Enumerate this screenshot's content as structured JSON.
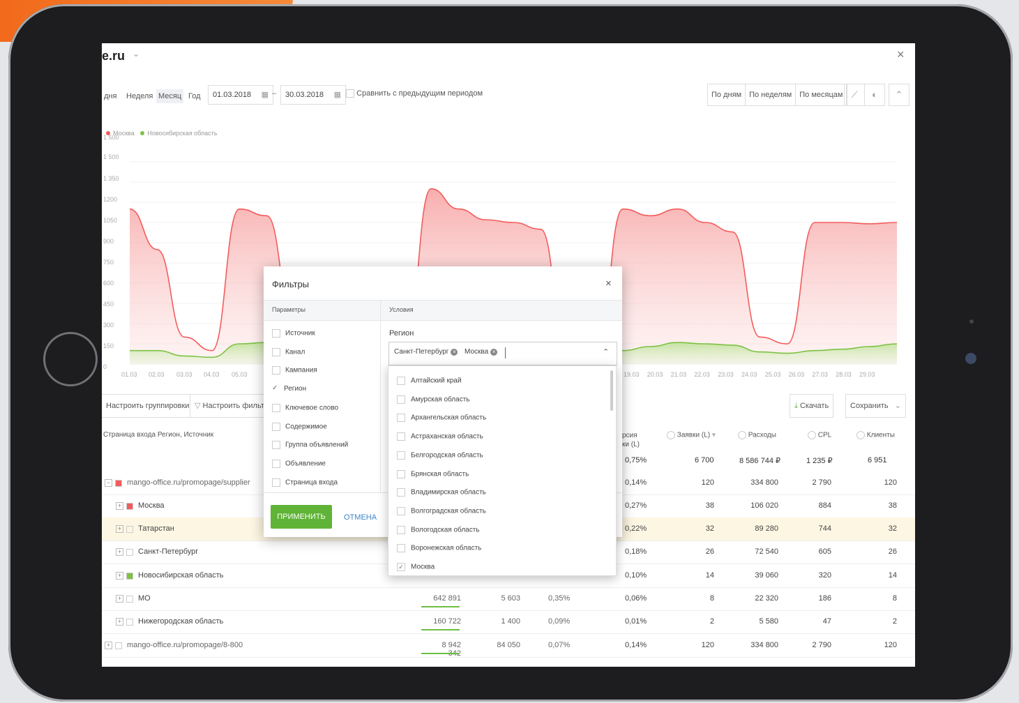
{
  "header": {
    "site": "e.ru",
    "chevron": "⌄",
    "close": "×"
  },
  "toolbar": {
    "ranges": [
      "дня",
      "Неделя",
      "Месяц",
      "Год"
    ],
    "active_range": "Месяц",
    "date_from": "01.03.2018",
    "dash": "–",
    "date_to": "30.03.2018",
    "compare_label": "Сравнить с предыдущим периодом",
    "group_by": [
      "По дням",
      "По неделям",
      "По месяцам"
    ]
  },
  "chart_data": {
    "type": "area",
    "legend": [
      "Москва",
      "Новосибирская область"
    ],
    "y_ticks": [
      "1 500",
      "1 500",
      "1 350",
      "1200",
      "1050",
      "900",
      "750",
      "600",
      "450",
      "300",
      "150",
      "0"
    ],
    "x_ticks_left": [
      "01.03",
      "02.03",
      "03.03",
      "04.03",
      "05.03"
    ],
    "x_ticks_right": [
      "19.03",
      "20.03",
      "21.03",
      "22.03",
      "23.03",
      "24.03",
      "25.03",
      "26.03",
      "27.03",
      "28.03",
      "29.03"
    ],
    "series": [
      {
        "name": "Москва",
        "color": "#f25c5c",
        "x": [
          "01.03",
          "02.03",
          "03.03",
          "04.03",
          "05.03",
          "06.03",
          "07.03",
          "08.03",
          "09.03",
          "10.03",
          "11.03",
          "12.03",
          "13.03",
          "14.03",
          "15.03",
          "16.03",
          "17.03",
          "18.03",
          "19.03",
          "20.03",
          "21.03",
          "22.03",
          "23.03",
          "24.03",
          "25.03",
          "26.03",
          "27.03",
          "28.03",
          "29.03"
        ],
        "values": [
          1150,
          850,
          200,
          100,
          1150,
          1100,
          300,
          0,
          0,
          0,
          0,
          1300,
          1150,
          1070,
          1050,
          1000,
          0,
          0,
          1150,
          1100,
          1150,
          1050,
          980,
          200,
          150,
          1050,
          1050,
          1040,
          1050
        ]
      },
      {
        "name": "Новосибирская область",
        "color": "#7cc243",
        "x": [
          "01.03",
          "02.03",
          "03.03",
          "04.03",
          "05.03",
          "06.03",
          "07.03",
          "08.03",
          "09.03",
          "10.03",
          "11.03",
          "12.03",
          "13.03",
          "14.03",
          "15.03",
          "16.03",
          "17.03",
          "18.03",
          "19.03",
          "20.03",
          "21.03",
          "22.03",
          "23.03",
          "24.03",
          "25.03",
          "26.03",
          "27.03",
          "28.03",
          "29.03"
        ],
        "values": [
          100,
          100,
          60,
          50,
          150,
          160,
          100,
          0,
          0,
          0,
          0,
          0,
          0,
          0,
          0,
          0,
          0,
          0,
          100,
          130,
          160,
          150,
          140,
          90,
          80,
          100,
          110,
          130,
          150
        ]
      }
    ],
    "ylim": [
      0,
      1500
    ]
  },
  "table_toolbar": {
    "grouping": "Настроить группировки",
    "filter": "Настроить фильтр",
    "download": "Скачать",
    "save": "Сохранить"
  },
  "table": {
    "first_header": "Страница входа Регион, Источник",
    "headers": [
      "рсия",
      "ки (L)",
      "Заявки (L)",
      "Расходы",
      "CPL",
      "Клиенты"
    ],
    "totals": [
      "0,75%",
      "6 700",
      "8 586 744 ₽",
      "1 235 ₽",
      "6 951"
    ],
    "rows": [
      {
        "name": "mango-office.ru/promopage/supplier",
        "sign": "−",
        "mid1": "",
        "mid2": "",
        "mid3": "",
        "conv": "0,14%",
        "leads": "120",
        "cost": "334 800",
        "cpl": "2 790",
        "clients": "120"
      },
      {
        "name": "Москва",
        "sign": "+",
        "mid1": "",
        "mid2": "",
        "mid3": "",
        "conv": "0,27%",
        "leads": "38",
        "cost": "106 020",
        "cpl": "884",
        "clients": "38"
      },
      {
        "name": "Татарстан",
        "sign": "+",
        "mid1": "",
        "mid2": "",
        "mid3": "",
        "conv": "0,22%",
        "leads": "32",
        "cost": "89 280",
        "cpl": "744",
        "clients": "32"
      },
      {
        "name": "Санкт-Петербург",
        "sign": "+",
        "mid1": "",
        "mid2": "",
        "mid3": "",
        "conv": "0,18%",
        "leads": "26",
        "cost": "72 540",
        "cpl": "605",
        "clients": "26"
      },
      {
        "name": "Новосибирская область",
        "sign": "+",
        "mid1": "",
        "mid2": "",
        "mid3": "",
        "conv": "0,10%",
        "leads": "14",
        "cost": "39 060",
        "cpl": "320",
        "clients": "14"
      },
      {
        "name": "МО",
        "sign": "+",
        "mid1": "642 891",
        "mid2": "5 603",
        "mid3": "0,35%",
        "conv": "0,06%",
        "leads": "8",
        "cost": "22 320",
        "cpl": "186",
        "clients": "8"
      },
      {
        "name": "Нижегородская область",
        "sign": "+",
        "mid1": "160 722",
        "mid2": "1 400",
        "mid3": "0,09%",
        "conv": "0,01%",
        "leads": "2",
        "cost": "5 580",
        "cpl": "47",
        "clients": "2"
      },
      {
        "name": "mango-office.ru/promopage/8-800",
        "sign": "+",
        "mid1": "8 942 342",
        "mid2": "84 050",
        "mid3": "0,07%",
        "conv": "0,14%",
        "leads": "120",
        "cost": "334 800",
        "cpl": "2 790",
        "clients": "120"
      }
    ]
  },
  "modal": {
    "title": "Фильтры",
    "close": "×",
    "col_params": "Параметры",
    "col_conditions": "Условия",
    "params": [
      "Источник",
      "Канал",
      "Кампания",
      "Регион",
      "Ключевое слово",
      "Содержимое",
      "Группа объявлений",
      "Объявление",
      "Страница входа"
    ],
    "checked_param": "Регион",
    "condition_label": "Регион",
    "tags": [
      "Санкт-Петербург",
      "Москва"
    ],
    "apply": "ПРИМЕНИТЬ",
    "cancel": "ОТМЕНА"
  },
  "dropdown": {
    "items": [
      "Алтайский край",
      "Амурская область",
      "Архангельская область",
      "Астраханская область",
      "Белгородская область",
      "Брянская область",
      "Владимирская область",
      "Волгоградская область",
      "Вологодская область",
      "Воронежская область",
      "Москва"
    ],
    "checked": "Москва"
  },
  "colors": {
    "accent_green": "#5fb336",
    "moscow_red": "#f25c5c",
    "novosib_green": "#7cc243",
    "link_blue": "#3b84c4"
  }
}
